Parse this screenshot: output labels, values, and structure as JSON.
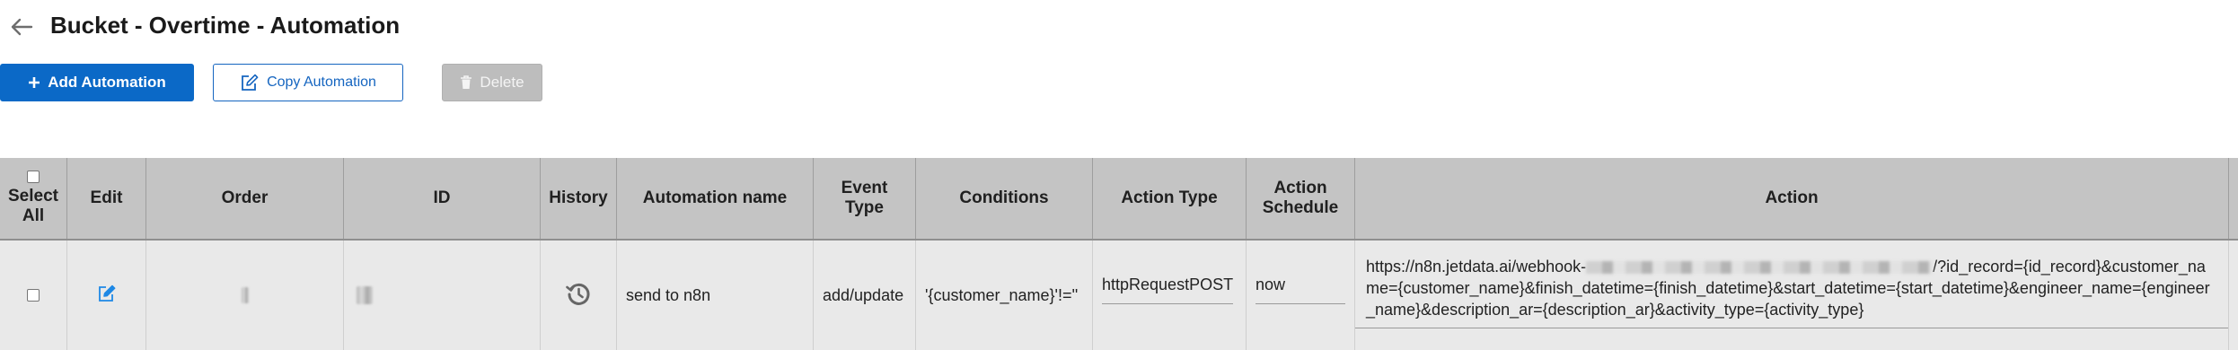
{
  "page": {
    "title": "Bucket - Overtime - Automation"
  },
  "toolbar": {
    "add_label": "Add Automation",
    "copy_label": "Copy Automation",
    "delete_label": "Delete"
  },
  "table": {
    "headers": {
      "select_all": "Select All",
      "edit": "Edit",
      "order": "Order",
      "id": "ID",
      "history": "History",
      "automation_name": "Automation name",
      "event_type": "Event Type",
      "conditions": "Conditions",
      "action_type": "Action Type",
      "action_schedule": "Action Schedule",
      "action": "Action"
    },
    "rows": [
      {
        "automation_name": "send to n8n",
        "event_type": "add/update",
        "conditions": "'{customer_name}'!=''",
        "action_type": "httpRequestPOST",
        "action_schedule": "now",
        "action_prefix": "https://n8n.jetdata.ai/webhook-",
        "action_rest": "/?id_record={id_record}&customer_name={customer_name}&finish_datetime={finish_datetime}&start_datetime={start_datetime}&engineer_name={engineer_name}&description_ar={description_ar}&activity_type={activity_type}"
      }
    ]
  },
  "colors": {
    "primary": "#0b69c7",
    "header_bg": "#c4c4c4",
    "row_bg": "#e9e9e9",
    "disabled": "#bdbdbd"
  },
  "icons": {
    "back": "arrow-left-icon",
    "add": "plus-icon",
    "copy": "edit-square-icon",
    "delete": "trash-icon",
    "edit": "edit-square-icon",
    "history": "history-icon"
  }
}
